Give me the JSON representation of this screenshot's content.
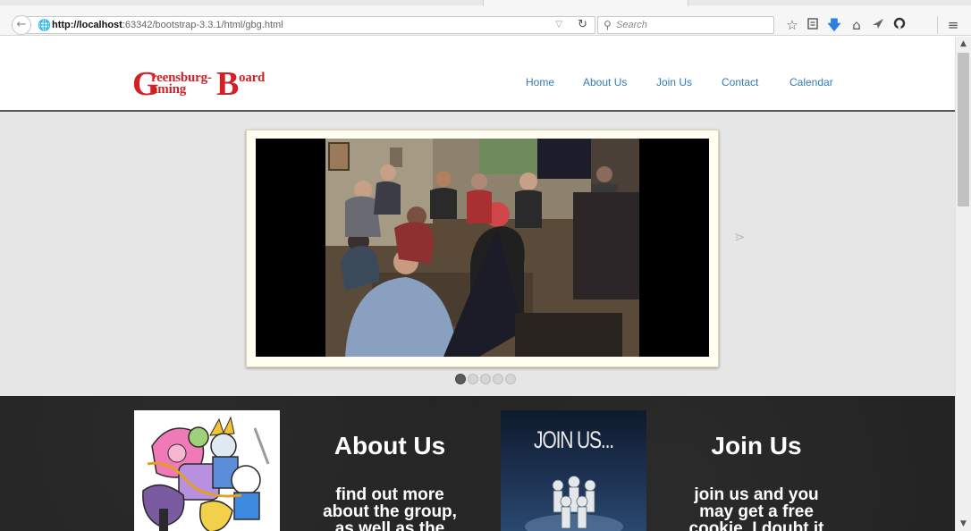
{
  "browser": {
    "url_host": "http://localhost",
    "url_rest": ":63342/bootstrap-3.3.1/html/gbg.html",
    "search_placeholder": "Search"
  },
  "site": {
    "logo": {
      "big_g": "G",
      "reensburg": "reensburg-",
      "aming": "aming",
      "big_b": "B",
      "oard": "oard"
    },
    "nav": [
      {
        "label": "Home"
      },
      {
        "label": "About Us"
      },
      {
        "label": "Join Us"
      },
      {
        "label": "Contact"
      },
      {
        "label": "Calendar"
      }
    ]
  },
  "carousel": {
    "slide_count": 5,
    "active_slide": 1,
    "next_glyph": "⋗"
  },
  "features": {
    "about": {
      "title": "About Us",
      "text": "find out more about the group, as well as the"
    },
    "join_image_caption": "JOIN US...",
    "join": {
      "title": "Join Us",
      "text": "join us and you may get a free cookie. I doubt it"
    }
  }
}
